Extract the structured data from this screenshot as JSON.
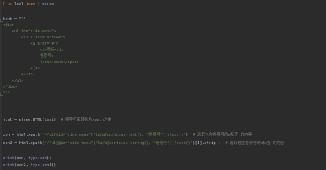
{
  "code": {
    "l1_kw1": "from",
    "l1_mod": " lxml ",
    "l1_kw2": "import",
    "l1_name": " etree",
    "l3": "text = \"\"\"",
    "l4": "<div>",
    "l5": "    <ul id=\"side-menu\">",
    "l6": "        <li class=\"active\">",
    "l7": "            <a href=\"#\">",
    "l8": "                <i>图标</i>",
    "l9": "                卷期号:",
    "l10": "                <span>xxxx</span>",
    "l11": "            </a>",
    "l12": "        </li>",
    "l13": "    </ul>",
    "l14": "</div>",
    "l15": "\"\"\"",
    "l17_code": "html = etree.HTML(text)",
    "l17_comment": "  # 将字符串转化为xpath对象",
    "l19_a": "con = html.xpath(",
    "l19_str": "'//ul[@id=\"side-menu\"]/li/a[contains(text(), \"卷期号\")]/text()'",
    "l19_b": ")",
    "l19_comment": "  # 选取包含卷期号的a标签 的内容",
    "l20_a": "con2 = html.xpath(",
    "l20_str": "'//ul[@id=\"side-menu\"]/li/a[contains(string(), \"卷期号\")]/text()'",
    "l20_b": ")[1].strip()",
    "l20_comment": "  # 选取包含卷期号的a标签 的内容",
    "l22_fn": "print",
    "l22_rest": "(con, ",
    "l22_fn2": "type",
    "l22_end": "(con))",
    "l23_fn": "print",
    "l23_rest": "(con2, ",
    "l23_fn2": "type",
    "l23_end": "(con2))"
  },
  "colors": {
    "background": "#2b2b2b",
    "keyword": "#cc7832",
    "string": "#6a8759",
    "comment": "#808080",
    "builtin": "#8888c6",
    "text": "#a9b7c6"
  }
}
